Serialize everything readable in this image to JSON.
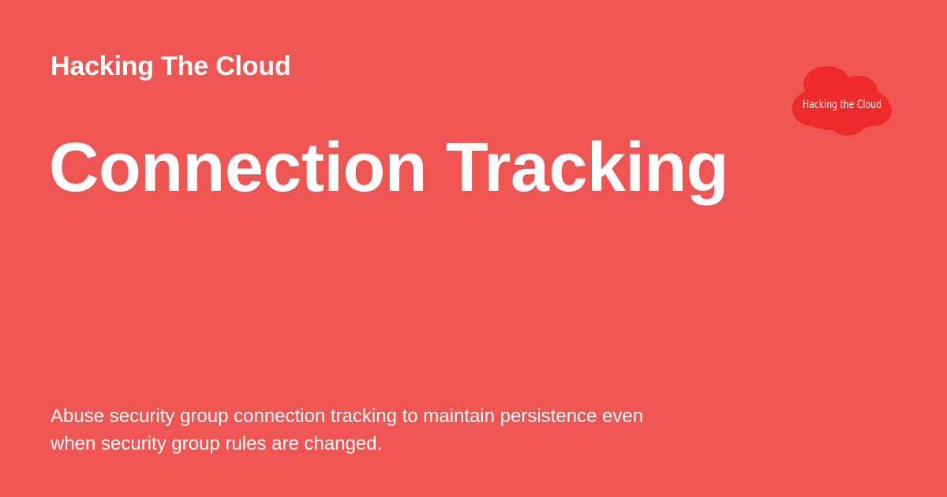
{
  "site": {
    "name": "Hacking The Cloud"
  },
  "page": {
    "title": "Connection Tracking",
    "description": "Abuse security group connection tracking to maintain persistence even when security group rules are changed."
  },
  "logo": {
    "text": "Hacking the Cloud",
    "icon": "cloud-logo-icon",
    "cloud_color": "#ee2a2a",
    "text_color": "#ffffff"
  },
  "colors": {
    "background": "#ef5552",
    "foreground": "#ffffff"
  }
}
